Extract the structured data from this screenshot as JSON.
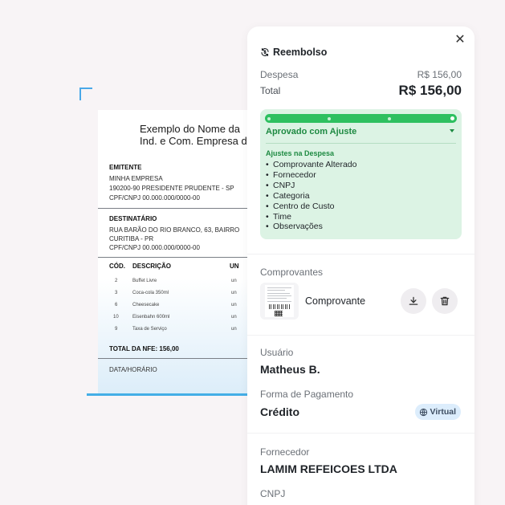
{
  "receipt": {
    "title_line1": "Exemplo do Nome da",
    "title_line2": "Ind. e Com. Empresa d",
    "emitente": {
      "heading": "EMITENTE",
      "line1": "MINHA EMPRESA",
      "line2": "190200-90 PRESIDENTE PRUDENTE - SP",
      "line3": "CPF/CNPJ 00.000.000/0000-00"
    },
    "destinatario": {
      "heading": "DESTINATÁRIO",
      "line1": "RUA BARÃO DO RIO BRANCO, 63, BAIRRO",
      "line2": "CURITIBA - PR",
      "line3": "CPF/CNPJ 00.000.000/0000-00"
    },
    "table": {
      "headers": [
        "CÓD.",
        "DESCRIÇÃO",
        "UN"
      ],
      "rows": [
        {
          "cod": "2",
          "desc": "Buffet Livre",
          "un": "un"
        },
        {
          "cod": "3",
          "desc": "Coca-cola 350ml",
          "un": "un"
        },
        {
          "cod": "6",
          "desc": "Cheesecake",
          "un": "un"
        },
        {
          "cod": "10",
          "desc": "Eisenbahn 600ml",
          "un": "un"
        },
        {
          "cod": "9",
          "desc": "Taxa de Serviço",
          "un": "un"
        }
      ]
    },
    "total": "TOTAL DA NFE: 156,00",
    "date_label": "DATA/HORÁRIO"
  },
  "panel": {
    "close_icon": "close-icon",
    "title": "Reembolso",
    "title_icon": "refund-icon",
    "despesa_label": "Despesa",
    "despesa_value": "R$ 156,00",
    "total_label": "Total",
    "total_value": "R$ 156,00",
    "status": {
      "label": "Aprovado com Ajuste",
      "progress_steps": 5,
      "current_step": 5,
      "color": "#2ec060",
      "adjustments_title": "Ajustes na Despesa",
      "adjustments": [
        "Comprovante Alterado",
        "Fornecedor",
        "CNPJ",
        "Categoria",
        "Centro de Custo",
        "Time",
        "Observações"
      ]
    },
    "comprovantes": {
      "label": "Comprovantes",
      "item_name": "Comprovante",
      "download_icon": "download-icon",
      "delete_icon": "trash-icon"
    },
    "usuario": {
      "label": "Usuário",
      "value": "Matheus B."
    },
    "pagamento": {
      "label": "Forma de Pagamento",
      "value": "Crédito",
      "badge": "Virtual",
      "badge_icon": "globe-icon"
    },
    "fornecedor": {
      "label": "Fornecedor",
      "value": "LAMIM REFEICOES LTDA"
    },
    "cnpj": {
      "label": "CNPJ"
    }
  }
}
